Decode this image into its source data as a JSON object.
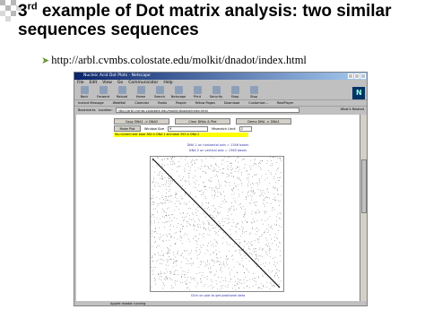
{
  "slide": {
    "title_prefix": "3",
    "title_sup": "rd",
    "title_rest": " example of Dot matrix analysis: two similar sequences sequences",
    "bullet_url": "http://arbl.cvmbs.colostate.edu/molkit/dnadot/index.html"
  },
  "browser": {
    "window_title": "Nucleic Acid Dot Plots - Netscape",
    "menu": [
      "File",
      "Edit",
      "View",
      "Go",
      "Communicator",
      "Help"
    ],
    "toolbar": [
      "Back",
      "Forward",
      "Reload",
      "Home",
      "Search",
      "Netscape",
      "Print",
      "Security",
      "Shop",
      "Stop"
    ],
    "personal": [
      "Instant Message",
      "WebMail",
      "Calendar",
      "Radio",
      "People",
      "Yellow Pages",
      "Download",
      "Customize...",
      "RealPlayer"
    ],
    "bookmarks_label": "Bookmarks",
    "location_label": "Location:",
    "location_value": "http://arbl.cvmbs.colostate.edu/molkit/dnadot/index.html",
    "related_label": "What's Related",
    "status_text": "Applet dnadot running"
  },
  "applet": {
    "copy_button": "Copy DNA1 -> DNA2",
    "clear_button": "Clear DNAs & Plot",
    "demo_button": "Demo DNA -> DNA1",
    "make_plot_button": "Make Plot",
    "window_size_label": "Window Size",
    "window_size_value": "9",
    "mismatch_label": "Mismatch Limit",
    "mismatch_value": "2",
    "message": "You clicked near base 384 in DNA 1 and base 393 in DNA 2",
    "dna1_info": "DNA 1 on horizontal axis = 1346 bases",
    "dna2_info": "DNA 2 on vertical axis = 1365 bases",
    "hint": "Click on plot to get positional data"
  }
}
